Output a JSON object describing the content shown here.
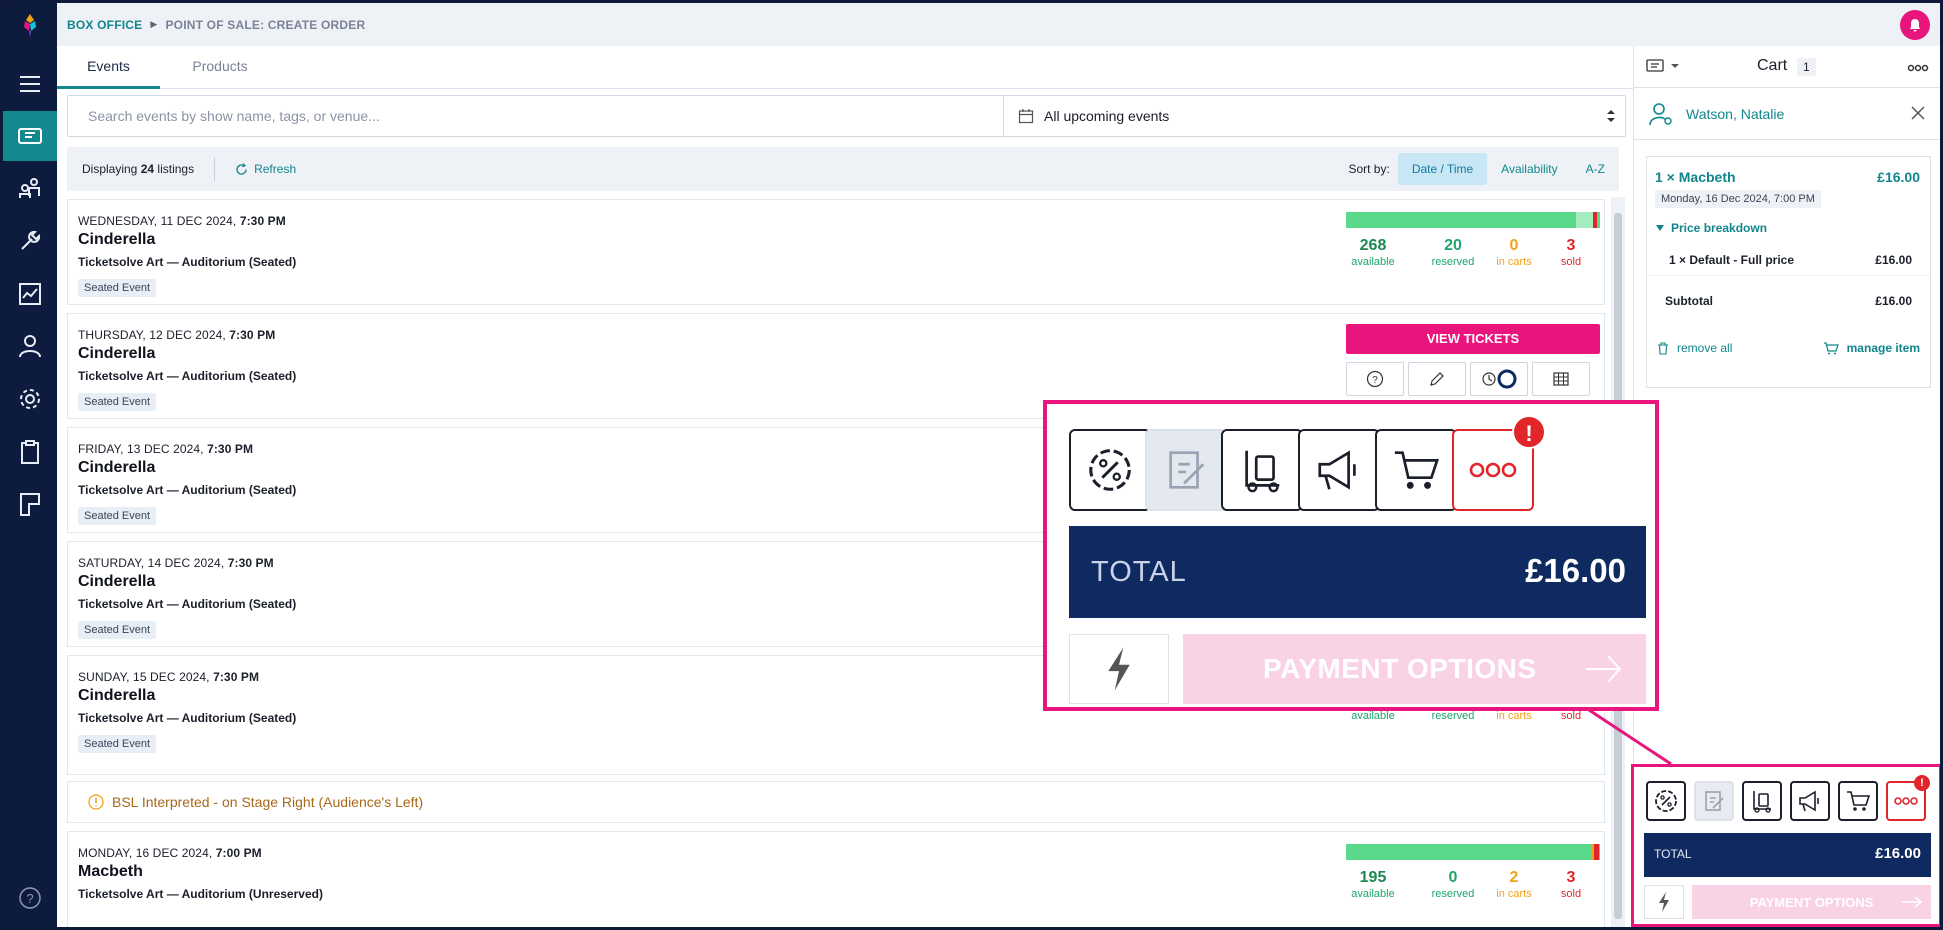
{
  "breadcrumb": {
    "section": "BOX OFFICE",
    "page": "POINT OF SALE: CREATE ORDER"
  },
  "sidebar": {
    "items": [
      {
        "icon": "logo-icon"
      },
      {
        "icon": "menu-icon"
      },
      {
        "icon": "ticket-icon",
        "active": true
      },
      {
        "icon": "people-icon"
      },
      {
        "icon": "tools-icon"
      },
      {
        "icon": "report-icon"
      },
      {
        "icon": "person-icon"
      },
      {
        "icon": "gear-icon"
      },
      {
        "icon": "clipboard-icon"
      },
      {
        "icon": "layout-icon"
      },
      {
        "icon": "help-icon"
      }
    ]
  },
  "tabs": [
    {
      "label": "Events",
      "active": true
    },
    {
      "label": "Products",
      "active": false
    }
  ],
  "search": {
    "placeholder": "Search events by show name, tags, or venue...",
    "date_filter": "All upcoming events"
  },
  "toolbar": {
    "display_prefix": "Displaying",
    "display_count": "24",
    "display_suffix": "listings",
    "refresh": "Refresh",
    "sort_label": "Sort by:",
    "sort_options": [
      "Date / Time",
      "Availability",
      "A-Z"
    ]
  },
  "events": [
    {
      "date": "WEDNESDAY, 11 DEC 2024,",
      "time": "7:30 PM",
      "name": "Cinderella",
      "venue": "Ticketsolve Art — Auditorium (Seated)",
      "tag": "Seated Event",
      "stats": {
        "available": "268",
        "reserved": "20",
        "in_carts": "0",
        "sold": "3"
      }
    },
    {
      "date": "THURSDAY, 12 DEC 2024,",
      "time": "7:30 PM",
      "name": "Cinderella",
      "venue": "Ticketsolve Art — Auditorium (Seated)",
      "tag": "Seated Event",
      "action": "VIEW TICKETS"
    },
    {
      "date": "FRIDAY, 13 DEC 2024,",
      "time": "7:30 PM",
      "name": "Cinderella",
      "venue": "Ticketsolve Art — Auditorium (Seated)",
      "tag": "Seated Event"
    },
    {
      "date": "SATURDAY, 14 DEC 2024,",
      "time": "7:30 PM",
      "name": "Cinderella",
      "venue": "Ticketsolve Art — Auditorium (Seated)",
      "tag": "Seated Event"
    },
    {
      "date": "SUNDAY, 15 DEC 2024,",
      "time": "7:30 PM",
      "name": "Cinderella",
      "venue": "Ticketsolve Art — Auditorium (Seated)",
      "tag": "Seated Event",
      "stats": {
        "available": "",
        "reserved": "",
        "in_carts": "",
        "sold": ""
      },
      "note": "BSL Interpreted - on Stage Right (Audience's Left)"
    },
    {
      "date": "MONDAY, 16 DEC 2024,",
      "time": "7:00 PM",
      "name": "Macbeth",
      "venue": "Ticketsolve Art — Auditorium (Unreserved)",
      "stats": {
        "available": "195",
        "reserved": "0",
        "in_carts": "2",
        "sold": "3"
      }
    }
  ],
  "stat_labels": {
    "available": "available",
    "reserved": "reserved",
    "in_carts": "in carts",
    "sold": "sold"
  },
  "cart": {
    "title": "Cart",
    "count": "1",
    "customer": "Watson, Natalie",
    "item": {
      "title": "1 × Macbeth",
      "price": "£16.00",
      "date": "Monday, 16 Dec 2024, 7:00 PM",
      "breakdown_label": "Price breakdown",
      "line": "1 × Default - Full price",
      "line_price": "£16.00",
      "subtotal_label": "Subtotal",
      "subtotal": "£16.00"
    },
    "remove_all": "remove all",
    "manage_item": "manage item"
  },
  "checkout": {
    "badge": "!",
    "total_label": "TOTAL",
    "total": "£16.00",
    "payment_label": "PAYMENT OPTIONS",
    "icons": [
      "discount-icon",
      "notes-icon",
      "delivery-icon",
      "marketing-icon",
      "cart-icon",
      "more-icon"
    ]
  },
  "colors": {
    "brand_pink": "#e8157c",
    "navy": "#0d1b3e",
    "teal": "#13898f",
    "total_navy": "#0e2a60"
  }
}
